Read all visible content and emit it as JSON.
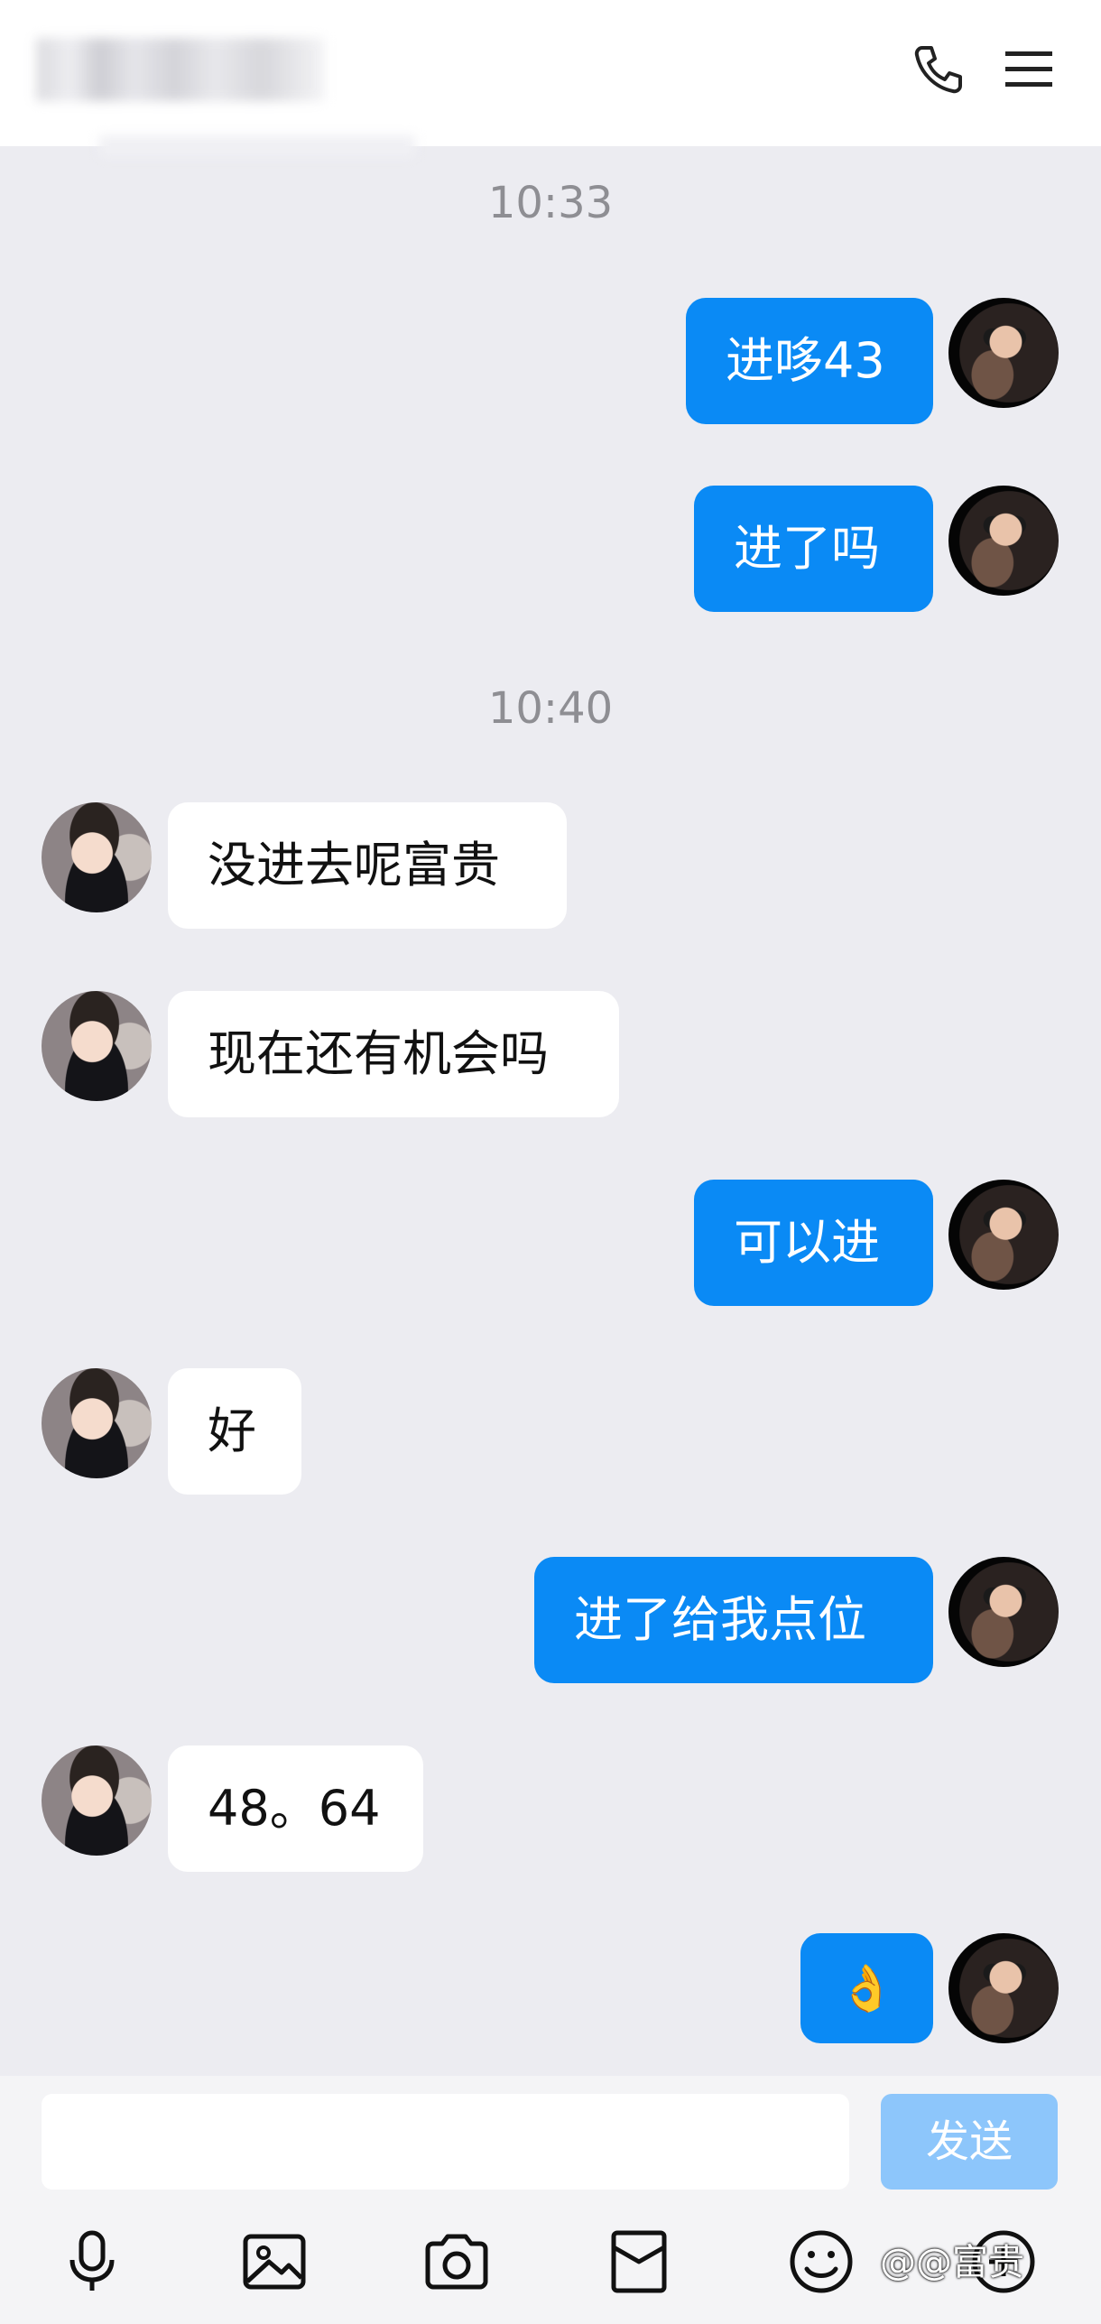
{
  "header": {
    "phone_icon": "phone-icon",
    "menu_icon": "hamburger-menu-icon"
  },
  "timestamps": [
    "10:33",
    "10:40"
  ],
  "messages": [
    {
      "from": "self",
      "text": "进哆43"
    },
    {
      "from": "self",
      "text": "进了吗"
    },
    {
      "from": "other",
      "text": "没进去呢富贵"
    },
    {
      "from": "other",
      "text": "现在还有机会吗"
    },
    {
      "from": "self",
      "text": "可以进"
    },
    {
      "from": "other",
      "text": "好"
    },
    {
      "from": "self",
      "text": "进了给我点位"
    },
    {
      "from": "other",
      "text": "48。64"
    },
    {
      "from": "self",
      "text": "👌"
    }
  ],
  "input": {
    "value": "",
    "send_label": "发送"
  },
  "toolbar": {
    "icons": [
      "microphone-icon",
      "image-icon",
      "camera-icon",
      "red-packet-icon",
      "emoji-icon",
      "more-icon"
    ]
  },
  "watermark": "@@富贵",
  "colors": {
    "outgoing_bubble": "#0a8af5",
    "incoming_bubble": "#ffffff",
    "send_button_disabled": "#8dc6fb",
    "background": "#ececf1"
  }
}
